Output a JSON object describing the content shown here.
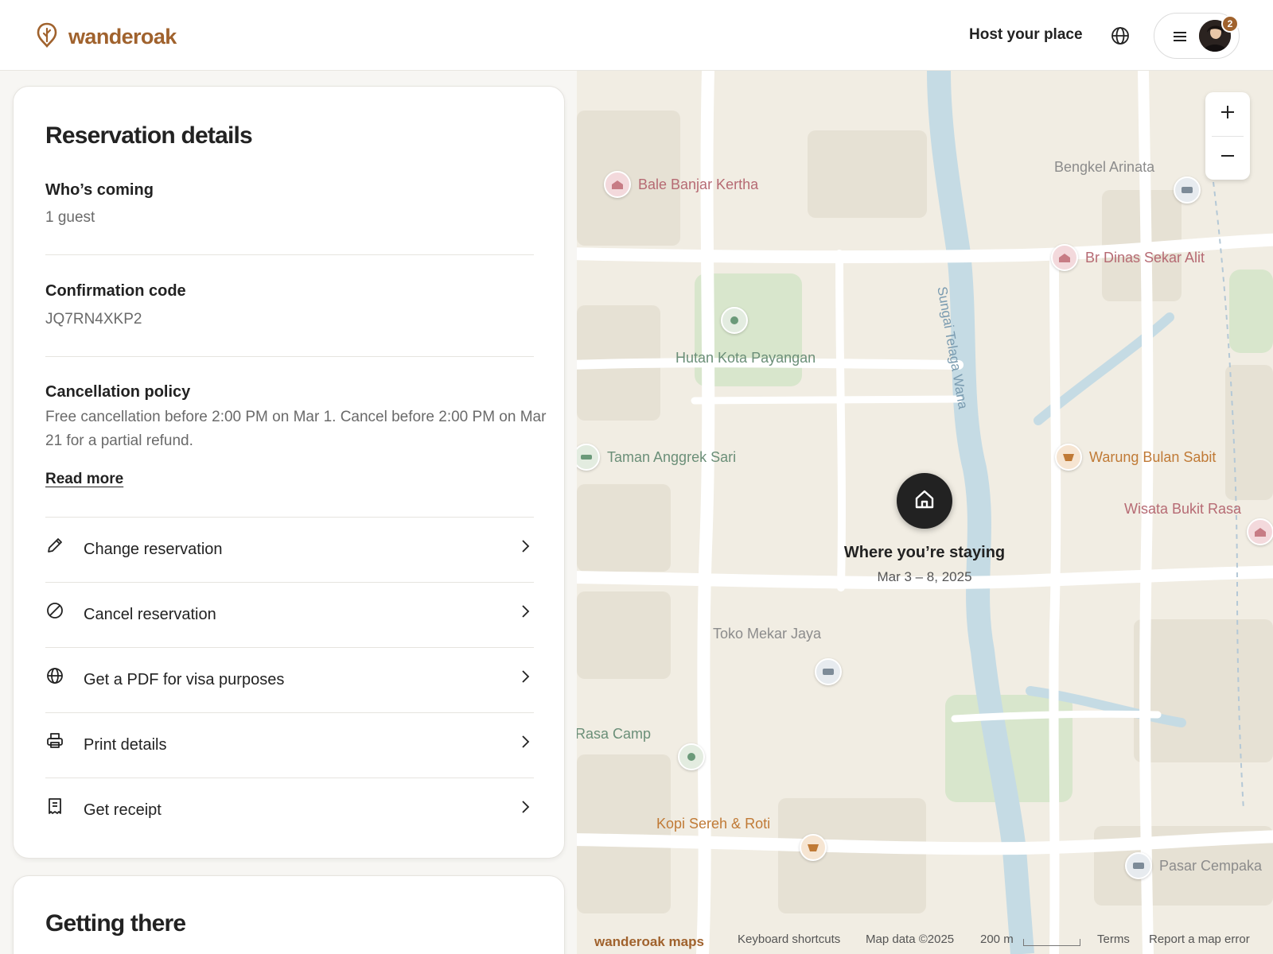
{
  "header": {
    "brand": "wanderoak",
    "host_link": "Host your place",
    "notification_count": "2",
    "brand_color": "#a0622d"
  },
  "reservation": {
    "title": "Reservation details",
    "guests_label": "Who’s coming",
    "guests_value": "1 guest",
    "code_label": "Confirmation code",
    "code_value": "JQ7RN4XKP2",
    "policy_label": "Cancellation policy",
    "policy_text": "Free cancellation before 2:00 PM on Mar 1. Cancel before 2:00 PM on Mar 21 for a partial refund.",
    "read_more": "Read more",
    "actions": [
      {
        "label": "Change reservation",
        "icon": "pencil-icon"
      },
      {
        "label": "Cancel reservation",
        "icon": "cancel-icon"
      },
      {
        "label": "Get a PDF for visa purposes",
        "icon": "globe-icon"
      },
      {
        "label": "Print details",
        "icon": "printer-icon"
      },
      {
        "label": "Get receipt",
        "icon": "receipt-icon"
      }
    ]
  },
  "getting_there": {
    "title": "Getting there"
  },
  "map": {
    "stay_title": "Where you’re staying",
    "stay_dates": "Mar 3 – 8, 2025",
    "river": "Sungai Telaga Wana",
    "pois": {
      "bale": "Bale Banjar Kertha",
      "bengkel": "Bengkel Arinata",
      "dinas": "Br Dinas Sekar Alit",
      "hutan": "Hutan Kota Payangan",
      "taman": "Taman Anggrek Sari",
      "warung": "Warung Bulan Sabit",
      "wisata": "Wisata Bukit Rasa",
      "toko": "Toko Mekar Jaya",
      "rasa": "Rasa Camp",
      "kopi": "Kopi Sereh & Roti",
      "pasar": "Pasar Cempaka"
    },
    "footer": {
      "brand": "wanderoak maps",
      "shortcuts": "Keyboard shortcuts",
      "map_data": "Map data ©2025",
      "scale": "200 m",
      "terms": "Terms",
      "report": "Report a map error"
    }
  }
}
